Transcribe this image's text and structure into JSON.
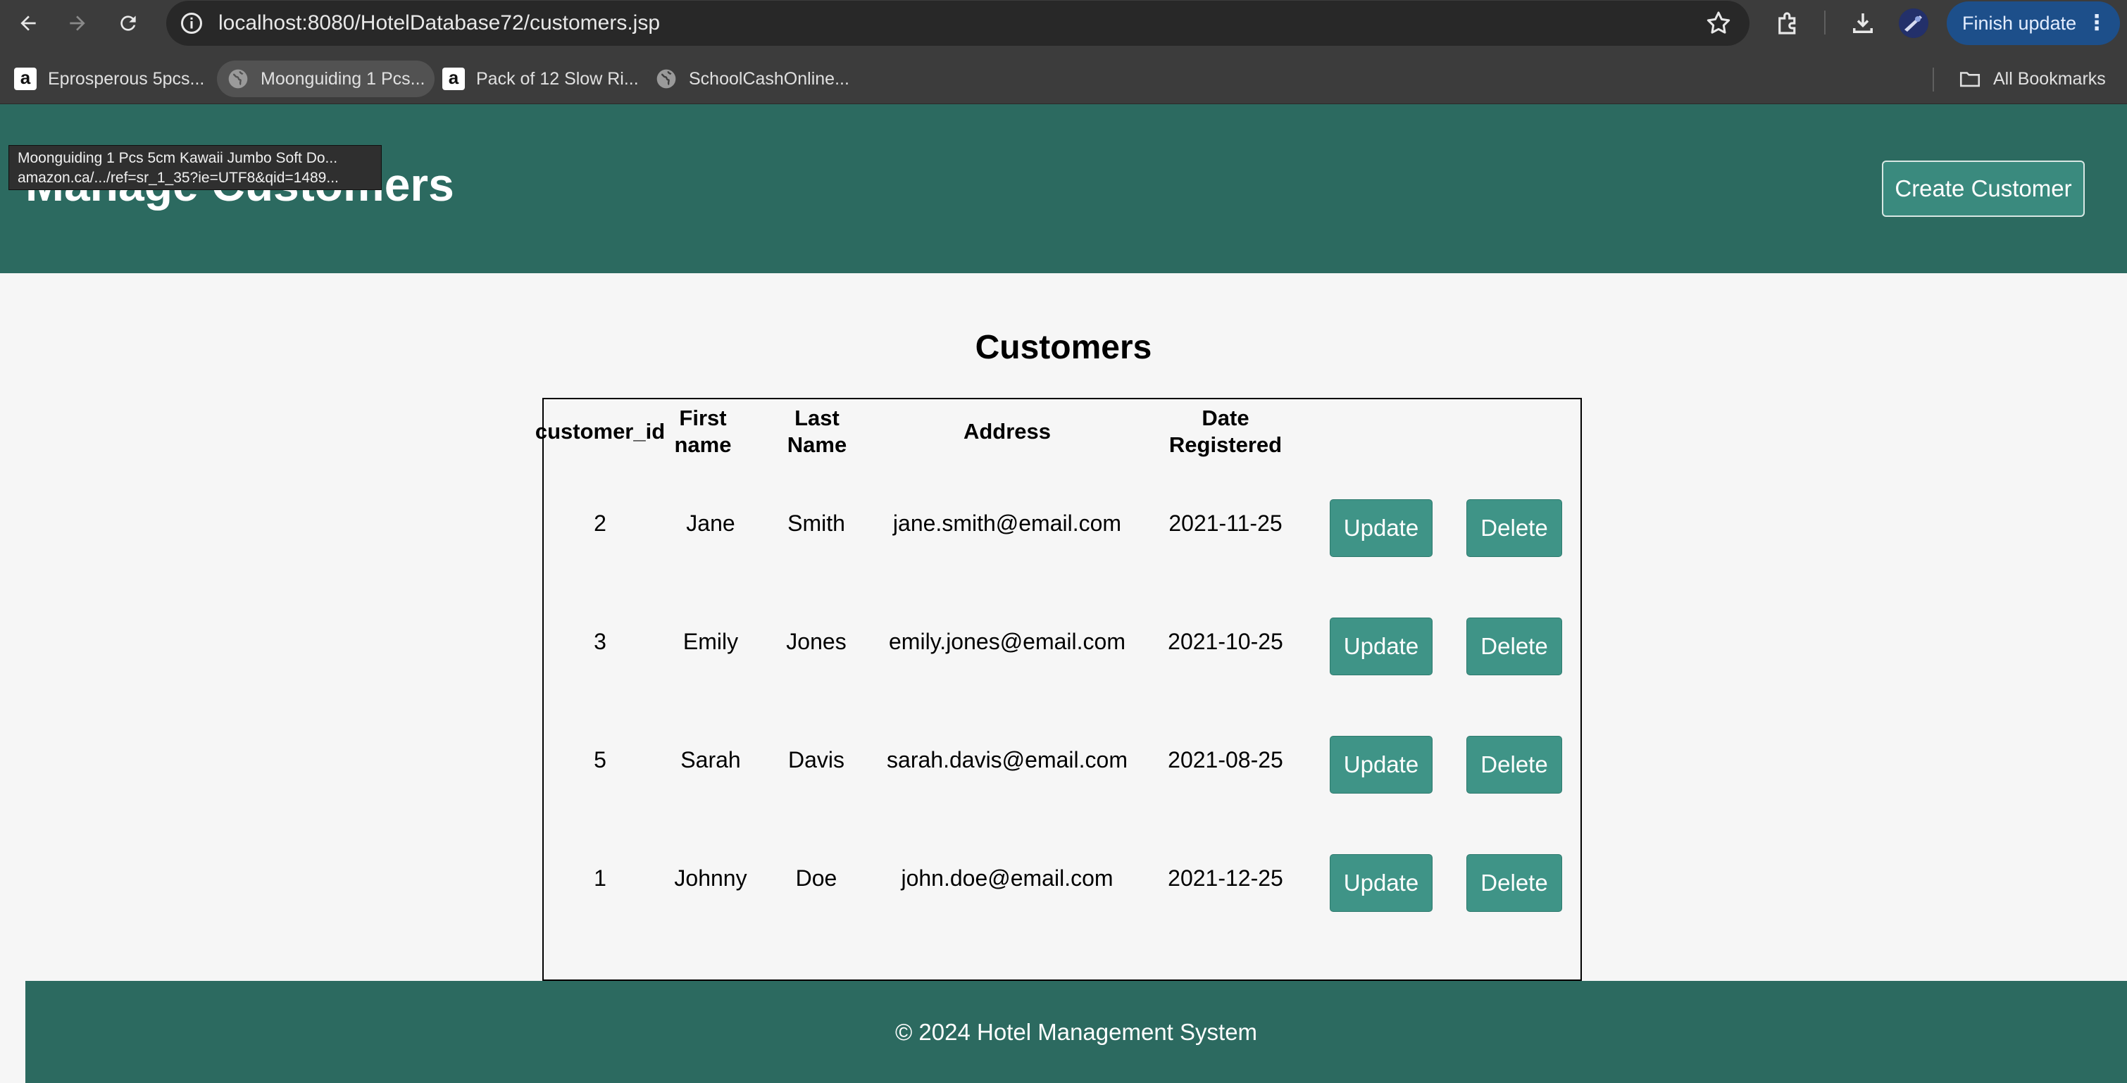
{
  "browser": {
    "url": "localhost:8080/HotelDatabase72/customers.jsp",
    "finish_update_label": "Finish update",
    "bookmarks": [
      {
        "label": "Eprosperous 5pcs...",
        "icon": "amazon-icon"
      },
      {
        "label": "Moonguiding 1 Pcs...",
        "icon": "globe-icon"
      },
      {
        "label": "Pack of 12 Slow Ri...",
        "icon": "amazon-icon"
      },
      {
        "label": "SchoolCashOnline...",
        "icon": "globe-icon"
      }
    ],
    "all_bookmarks_label": "All Bookmarks",
    "tooltip": {
      "line1": "Moonguiding 1 Pcs 5cm Kawaii Jumbo Soft Do...",
      "line2": "amazon.ca/.../ref=sr_1_35?ie=UTF8&qid=1489..."
    }
  },
  "header": {
    "title": "Manage Customers",
    "create_button": "Create Customer"
  },
  "main": {
    "section_title": "Customers",
    "table": {
      "columns": [
        "customer_id",
        "First name",
        "Last Name",
        "Address",
        "Date Registered"
      ],
      "update_label": "Update",
      "delete_label": "Delete",
      "rows": [
        {
          "customer_id": "2",
          "first_name": "Jane",
          "last_name": "Smith",
          "address": "jane.smith@email.com",
          "date_registered": "2021-11-25"
        },
        {
          "customer_id": "3",
          "first_name": "Emily",
          "last_name": "Jones",
          "address": "emily.jones@email.com",
          "date_registered": "2021-10-25"
        },
        {
          "customer_id": "5",
          "first_name": "Sarah",
          "last_name": "Davis",
          "address": "sarah.davis@email.com",
          "date_registered": "2021-08-25"
        },
        {
          "customer_id": "1",
          "first_name": "Johnny",
          "last_name": "Doe",
          "address": "john.doe@email.com",
          "date_registered": "2021-12-25"
        }
      ]
    }
  },
  "footer": {
    "text": "© 2024 Hotel Management System"
  },
  "colors": {
    "header_bg": "#2c6a60",
    "button_bg": "#3f9487",
    "page_bg": "#f6f6f6"
  }
}
